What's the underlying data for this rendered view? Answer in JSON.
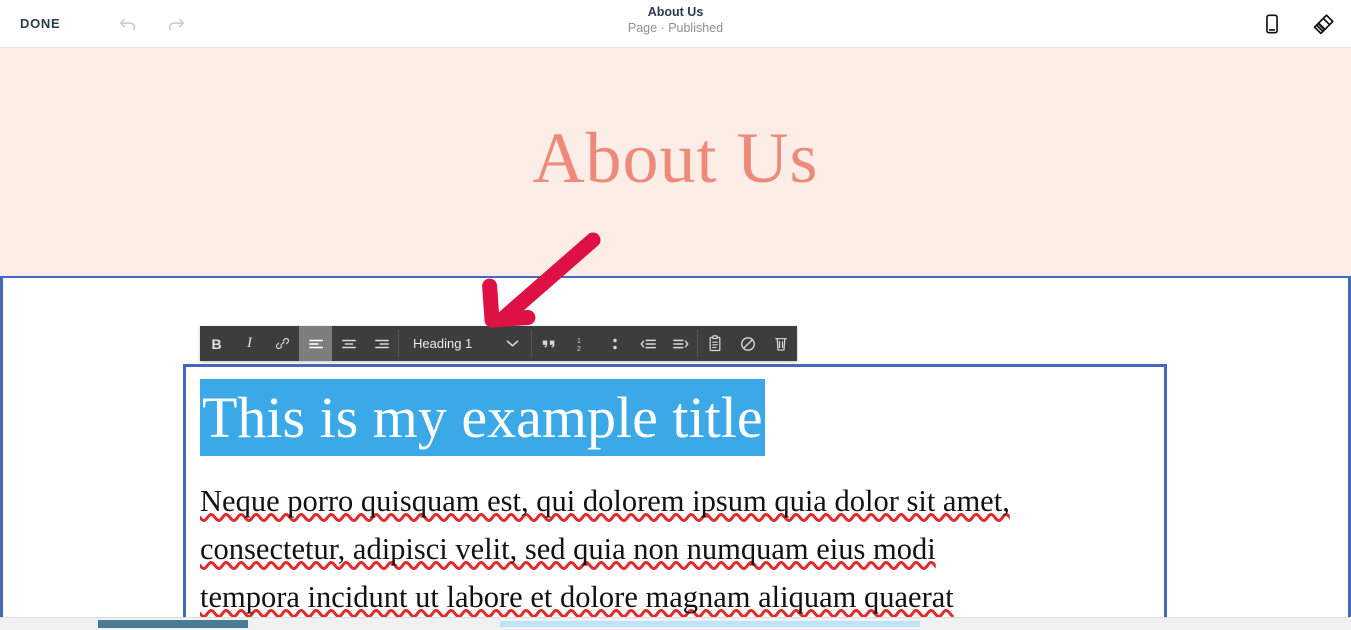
{
  "topbar": {
    "done_label": "DONE",
    "undo_icon": "undo-arrow-icon",
    "redo_icon": "redo-arrow-icon",
    "page_title": "About Us",
    "page_status": "Page · Published",
    "mobile_preview_icon": "mobile-phone-icon",
    "design_icon": "paintbrush-icon"
  },
  "hero": {
    "heading": "About Us",
    "background_color": "#fceee6",
    "heading_color": "#ef8a7a"
  },
  "toolbar": {
    "buttons": [
      {
        "name": "bold",
        "label": "B",
        "active": false
      },
      {
        "name": "italic",
        "label": "I",
        "active": false
      },
      {
        "name": "link",
        "label": "link-icon",
        "active": false
      },
      {
        "name": "align-left",
        "label": "align-left-icon",
        "active": true
      },
      {
        "name": "align-center",
        "label": "align-center-icon",
        "active": false
      },
      {
        "name": "align-right",
        "label": "align-right-icon",
        "active": false
      },
      {
        "name": "blockquote",
        "label": "quote-icon",
        "active": false
      },
      {
        "name": "numbered-list",
        "label": "numbered-list-icon",
        "active": false
      },
      {
        "name": "bulleted-list",
        "label": "bulleted-list-icon",
        "active": false
      },
      {
        "name": "outdent",
        "label": "outdent-icon",
        "active": false
      },
      {
        "name": "indent",
        "label": "indent-icon",
        "active": false
      },
      {
        "name": "paste",
        "label": "clipboard-icon",
        "active": false
      },
      {
        "name": "clear-formatting",
        "label": "no-entry-icon",
        "active": false
      },
      {
        "name": "delete",
        "label": "trash-icon",
        "active": false
      }
    ],
    "style_select": {
      "value": "Heading 1",
      "chevron": "chevron-down-icon"
    },
    "background_color": "#3d3d3d",
    "active_background_color": "#7d7d7d"
  },
  "text_block": {
    "title": "This is my example title",
    "title_selected": true,
    "selection_color": "#3ba9e8",
    "body_lines": [
      "Neque porro quisquam est, qui dolorem ipsum quia dolor sit amet,",
      "consectetur, adipisci velit, sed quia non numquam eius modi",
      "tempora incidunt ut labore et dolore magnam aliquam quaerat"
    ],
    "border_color": "#4467c0"
  },
  "annotation": {
    "arrow_color": "#dd1144",
    "arrow_direction": "down-left"
  },
  "scrollbar": {
    "orientation": "horizontal",
    "track_color": "#f1f1f1",
    "thumb_color": "#4a7c96"
  }
}
